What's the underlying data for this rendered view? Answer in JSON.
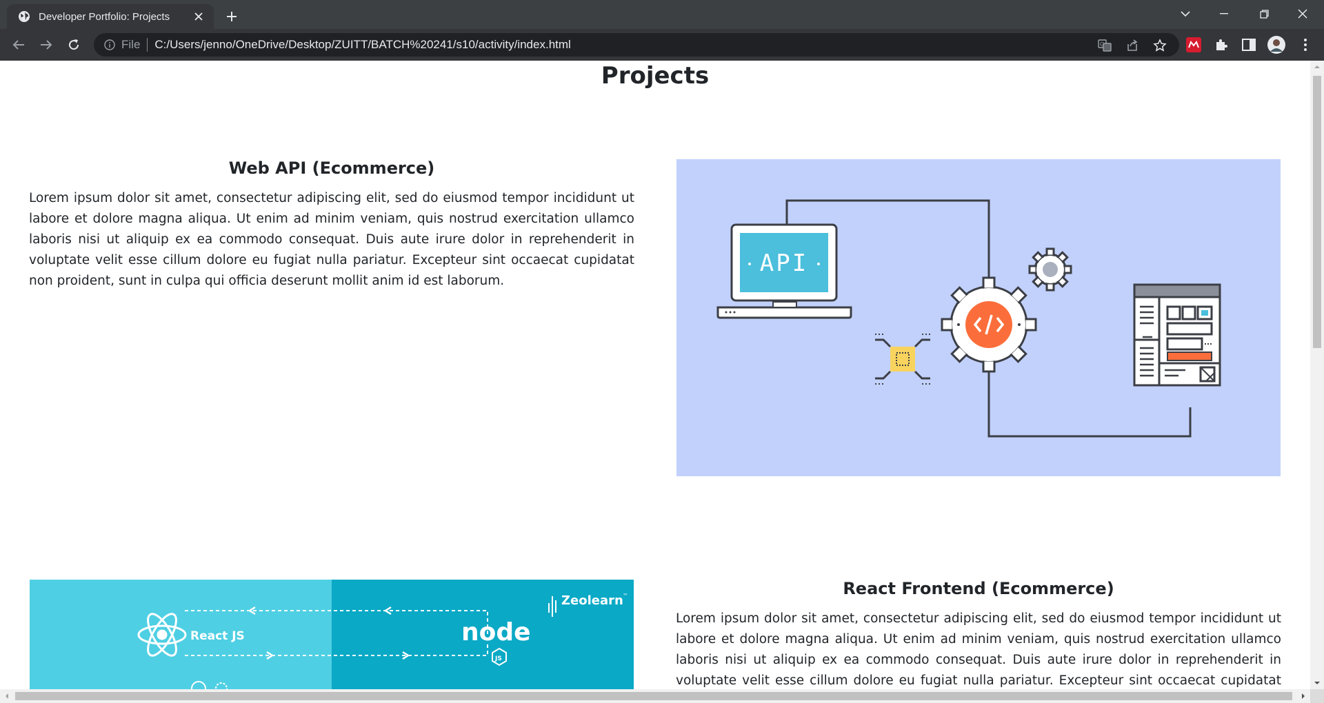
{
  "browser": {
    "tab_title": "Developer Portfolio: Projects",
    "file_label": "File",
    "url": "C:/Users/jenno/OneDrive/Desktop/ZUITT/BATCH%20241/s10/activity/index.html"
  },
  "page": {
    "title": "Projects",
    "projects": [
      {
        "title": "Web API (Ecommerce)",
        "description": "Lorem ipsum dolor sit amet, consectetur adipiscing elit, sed do eiusmod tempor incididunt ut labore et dolore magna aliqua. Ut enim ad minim veniam, quis nostrud exercitation ullamco laboris nisi ut aliquip ex ea commodo consequat. Duis aute irure dolor in reprehenderit in voluptate velit esse cillum dolore eu fugiat nulla pariatur. Excepteur sint occaecat cupidatat non proident, sunt in culpa qui officia deserunt mollit anim id est laborum.",
        "image_text": "API"
      },
      {
        "title": "React Frontend (Ecommerce)",
        "description": "Lorem ipsum dolor sit amet, consectetur adipiscing elit, sed do eiusmod tempor incididunt ut labore et dolore magna aliqua. Ut enim ad minim veniam, quis nostrud exercitation ullamco laboris nisi ut aliquip ex ea commodo consequat. Duis aute irure dolor in reprehenderit in voluptate velit esse cillum dolore eu fugiat nulla pariatur. Excepteur sint occaecat cupidatat non proident, sunt in culpa qui officia deserunt mollit anim id est laborum.",
        "image_labels": {
          "react": "React JS",
          "node": "node",
          "node_sub": "JS",
          "brand": "Zeolearn",
          "brand_tm": "™"
        }
      }
    ]
  },
  "colors": {
    "chrome_dark": "#35363a",
    "tab_strip": "#3c4043",
    "api_bg": "#c2d1fb",
    "react_left": "#4fcfe3",
    "react_right": "#0aa9c6",
    "api_screen": "#4bbfdc",
    "gear_center": "#fb6e3b",
    "chip": "#f8d35e"
  }
}
